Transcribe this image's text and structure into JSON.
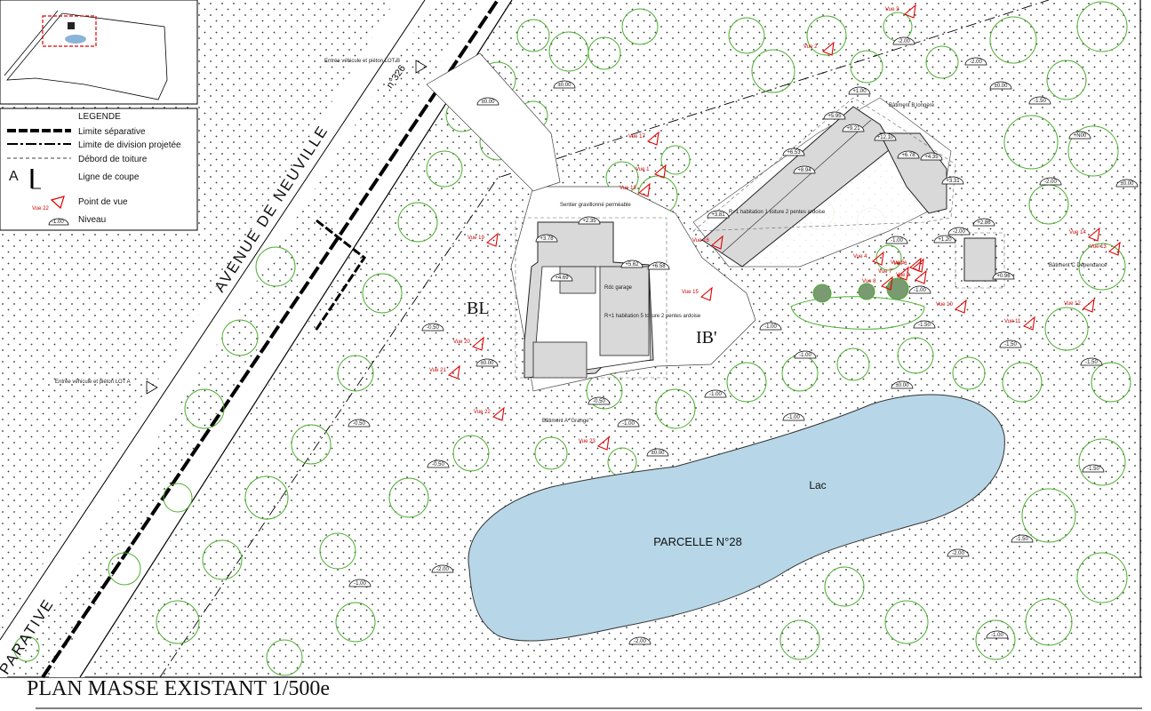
{
  "title": "PLAN MASSE EXISTANT 1/500e",
  "legend": {
    "heading": "LEGENDE",
    "items": [
      {
        "key": "limite-separative",
        "label": "Limite séparative"
      },
      {
        "key": "limite-division",
        "label": "Limite de division projetée"
      },
      {
        "key": "debord-toiture",
        "label": "Débord de toiture"
      },
      {
        "key": "ligne-coupe",
        "label": "Ligne de coupe",
        "symbol": "A"
      },
      {
        "key": "point-de-vue",
        "label": "Point de vue",
        "symbol": "Vue 22"
      },
      {
        "key": "niveau",
        "label": "Niveau",
        "symbol": "-1.00"
      }
    ]
  },
  "labels": {
    "street": "AVENUE DE NEUVILLE",
    "separative": "PARATIVE",
    "entry_b": "Entrée véhicule et piéton LOT B",
    "entry_a": "Entrée véhicule et piéton LOT A",
    "lot_bl": "BL",
    "lot_bprime": "IB'",
    "lake": "Lac",
    "parcel": "PARCELLE N°28",
    "path": "Sentier gravillonné perméable",
    "num_326": "n°326",
    "bat_b": "Bâtiment B longère",
    "bat_c": "Bâtiment C Dépendance",
    "bat_a": "Bâtiment A \"Grange\"",
    "garage": "Rdc garage",
    "hab_grange": "R+1 habitation 5 toiture 2 pentes ardoise",
    "hab_longere": "R+1 habitation 1 toiture 2 pentes ardoise"
  },
  "levels": [
    "±0.00",
    "-2.00",
    "-2.00",
    "+1.00",
    "-1.50",
    "+N00",
    "±0.00",
    "±0.00",
    "-0.50",
    "±0.00",
    "±0.00",
    "-1.00",
    "-1.00",
    "-1.50",
    "-1.50",
    "-2.00",
    "-1.00",
    "-2.00",
    "-1.50",
    "-1.00",
    "±0.00",
    "-1.50",
    "-0.50",
    "-0.50",
    "-1.00",
    "-0.50",
    "±0.00",
    "-1.00",
    "-1.00",
    "-2.00",
    "-1.50",
    "-2.00",
    "+3.78",
    "+4.69",
    "+5.62",
    "+6.58",
    "+2.35",
    "+3.81",
    "+5.95",
    "+6.53",
    "+8.94",
    "+9.21",
    "+12.10",
    "+6.78",
    "+4.35",
    "+3.31",
    "+2.86",
    "+1.20",
    "+0.96",
    "-2.00",
    "-1.00",
    "-1.00"
  ],
  "views": [
    "Vue 2",
    "Vue 3",
    "Vue 17",
    "Vue 1",
    "Vue 18",
    "Vue 19",
    "Vue 16",
    "Vue 15",
    "Vue 20",
    "Vue 21",
    "Vue 22",
    "Vue 23",
    "Vue 4",
    "Vue 5",
    "Vue 6",
    "Vue 7",
    "Vue 8",
    "Vue 9",
    "Vue 10",
    "Vue 11",
    "Vue 12",
    "Vue 13",
    "Vue 14"
  ],
  "colors": {
    "lake": "#b7d7e8",
    "vegetation": "#4caf30",
    "building_fill": "#d9d9d9",
    "view_marker": "#e00000",
    "boundary": "#000000"
  }
}
